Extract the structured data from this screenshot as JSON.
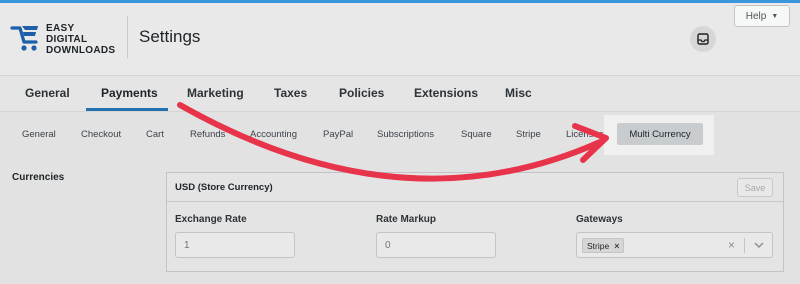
{
  "app": {
    "logo_lines": [
      "EASY",
      "DIGITAL",
      "DOWNLOADS"
    ],
    "page_title": "Settings",
    "help_label": "Help",
    "help_arrow": "▼"
  },
  "main_tabs": [
    {
      "label": "General"
    },
    {
      "label": "Payments",
      "active": true
    },
    {
      "label": "Marketing"
    },
    {
      "label": "Taxes"
    },
    {
      "label": "Policies"
    },
    {
      "label": "Extensions"
    },
    {
      "label": "Misc"
    }
  ],
  "sub_tabs": [
    {
      "label": "General"
    },
    {
      "label": "Checkout"
    },
    {
      "label": "Cart"
    },
    {
      "label": "Refunds"
    },
    {
      "label": "Accounting"
    },
    {
      "label": "PayPal"
    },
    {
      "label": "Subscriptions"
    },
    {
      "label": "Square"
    },
    {
      "label": "Stripe"
    },
    {
      "label": "Licenses"
    },
    {
      "label": "Multi Currency",
      "active": true
    }
  ],
  "section": {
    "label": "Currencies"
  },
  "currency_card": {
    "title": "USD (Store Currency)",
    "save_label": "Save",
    "exchange_rate": {
      "label": "Exchange Rate",
      "placeholder": "1"
    },
    "rate_markup": {
      "label": "Rate Markup",
      "placeholder": "0"
    },
    "gateways": {
      "label": "Gateways",
      "selected": [
        "Stripe"
      ],
      "remove_glyph": "×",
      "clear_glyph": "×"
    }
  },
  "colors": {
    "accent": "#2271b1",
    "annotation_arrow": "#e8344a",
    "top_bar": "#3a96dd"
  }
}
